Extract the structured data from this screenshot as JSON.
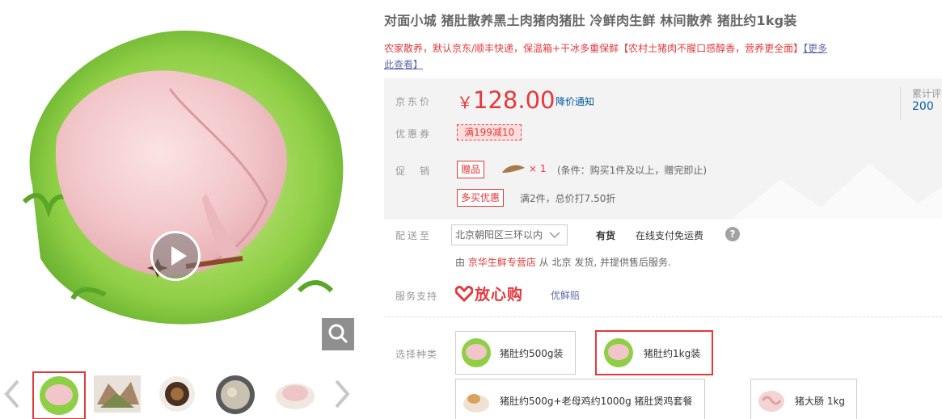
{
  "product": {
    "title": "对面小城 猪肚散养黑土肉猪肉猪肚 冷鲜肉生鲜 林间散养 猪肚约1kg装",
    "promo_text": "农家散养，默认京东/顺丰快递，保温箱+干冰多重保鲜【农村土猪肉不腥口感醇香，营养更全面】",
    "promo_link": "【更多",
    "promo_link_2": "此查看】"
  },
  "summary": {
    "price_label": "京东价",
    "currency": "￥",
    "price": "128.00",
    "price_notify": "降价通知",
    "cumulative_label": "累计评",
    "cumulative_value": "200",
    "coupon_label": "优惠券",
    "coupon": "满199减10",
    "promo_label": "促　销",
    "gift_tag": "赠品",
    "gift_qty": "× 1",
    "gift_condition": "(条件：购买1件及以上，赠完即止)",
    "multi_buy_tag": "多买优惠",
    "multi_buy_desc": "满2件，总价打7.50折"
  },
  "delivery": {
    "label": "配送至",
    "address": "北京朝阳区三环以内",
    "stock": "有货",
    "shipping": "在线支付免运费",
    "help": "?",
    "sold_by_prefix": "由",
    "shop": "京华生鲜专营店",
    "sold_by_suffix": "从 北京 发货, 并提供售后服务."
  },
  "service": {
    "label": "服务支持",
    "logo_text": "放心购",
    "sub": "优鲜赔"
  },
  "variants": {
    "label": "选择种类",
    "items": [
      {
        "label": "猪肚约500g装"
      },
      {
        "label": "猪肚约1kg装"
      },
      {
        "label": "猪肚约500g+老母鸡约1000g 猪肚煲鸡套餐"
      },
      {
        "label": "猪大肠 1kg"
      }
    ],
    "selected_index": 1
  },
  "gallery": {
    "thumb_count": 5,
    "active_index": 0
  },
  "colors": {
    "accent": "#e4393c",
    "link": "#005aa0",
    "summary_bg": "#f3f3f3"
  }
}
